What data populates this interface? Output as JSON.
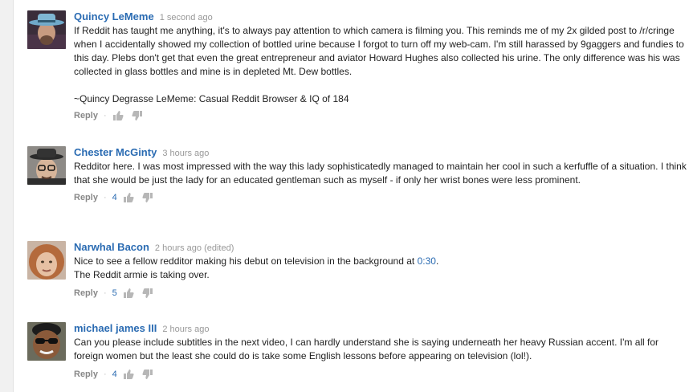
{
  "colors": {
    "link": "#2a6bb2",
    "meta": "#999999",
    "text": "#222222"
  },
  "comments": [
    {
      "author": "Quincy LeMeme",
      "time": "1 second ago",
      "text": "If Reddit has taught me anything, it's to always pay attention to which camera is filming you. This reminds me of my 2x gilded post to /r/cringe when I accidentally showed my collection of bottled urine because I forgot to turn off my web-cam. I'm still harassed by 9gaggers and fundies to this day. Plebs don't get that even the great entrepreneur and aviator Howard Hughes also collected his urine. The only difference was his was collected in glass bottles and mine is in depleted Mt. Dew bottles.\n\n~Quincy Degrasse LeMeme: Casual Reddit Browser & IQ of 184",
      "reply": "Reply",
      "likes": "",
      "avatar_icon": "fedora-user-avatar"
    },
    {
      "author": "Chester McGinty",
      "time": "3 hours ago",
      "text": "Redditor here. I was most impressed with the way this lady sophisticatedly managed to maintain her cool in such a kerfuffle of a situation. I think that she would be just the lady for an educated gentleman such as myself - if only her wrist bones were less prominent.",
      "reply": "Reply",
      "likes": "4",
      "avatar_icon": "fedora-glasses-avatar"
    },
    {
      "author": "Narwhal Bacon",
      "time": "2 hours ago (edited)",
      "text_before": "Nice to see a fellow redditor making his debut on television in the background at ",
      "timestamp_link": "0:30",
      "text_after": ".\nThe Reddit armie is taking over.",
      "reply": "Reply",
      "likes": "5",
      "avatar_icon": "redhead-avatar"
    },
    {
      "author": "michael james III",
      "time": "2 hours ago",
      "text": "Can you please include subtitles in the next video, I can hardly understand she is saying underneath her heavy Russian accent. I'm all for foreign women but the least she could do is take some English lessons before appearing on television (lol!).",
      "reply": "Reply",
      "likes": "4",
      "avatar_icon": "sunglasses-avatar"
    }
  ]
}
